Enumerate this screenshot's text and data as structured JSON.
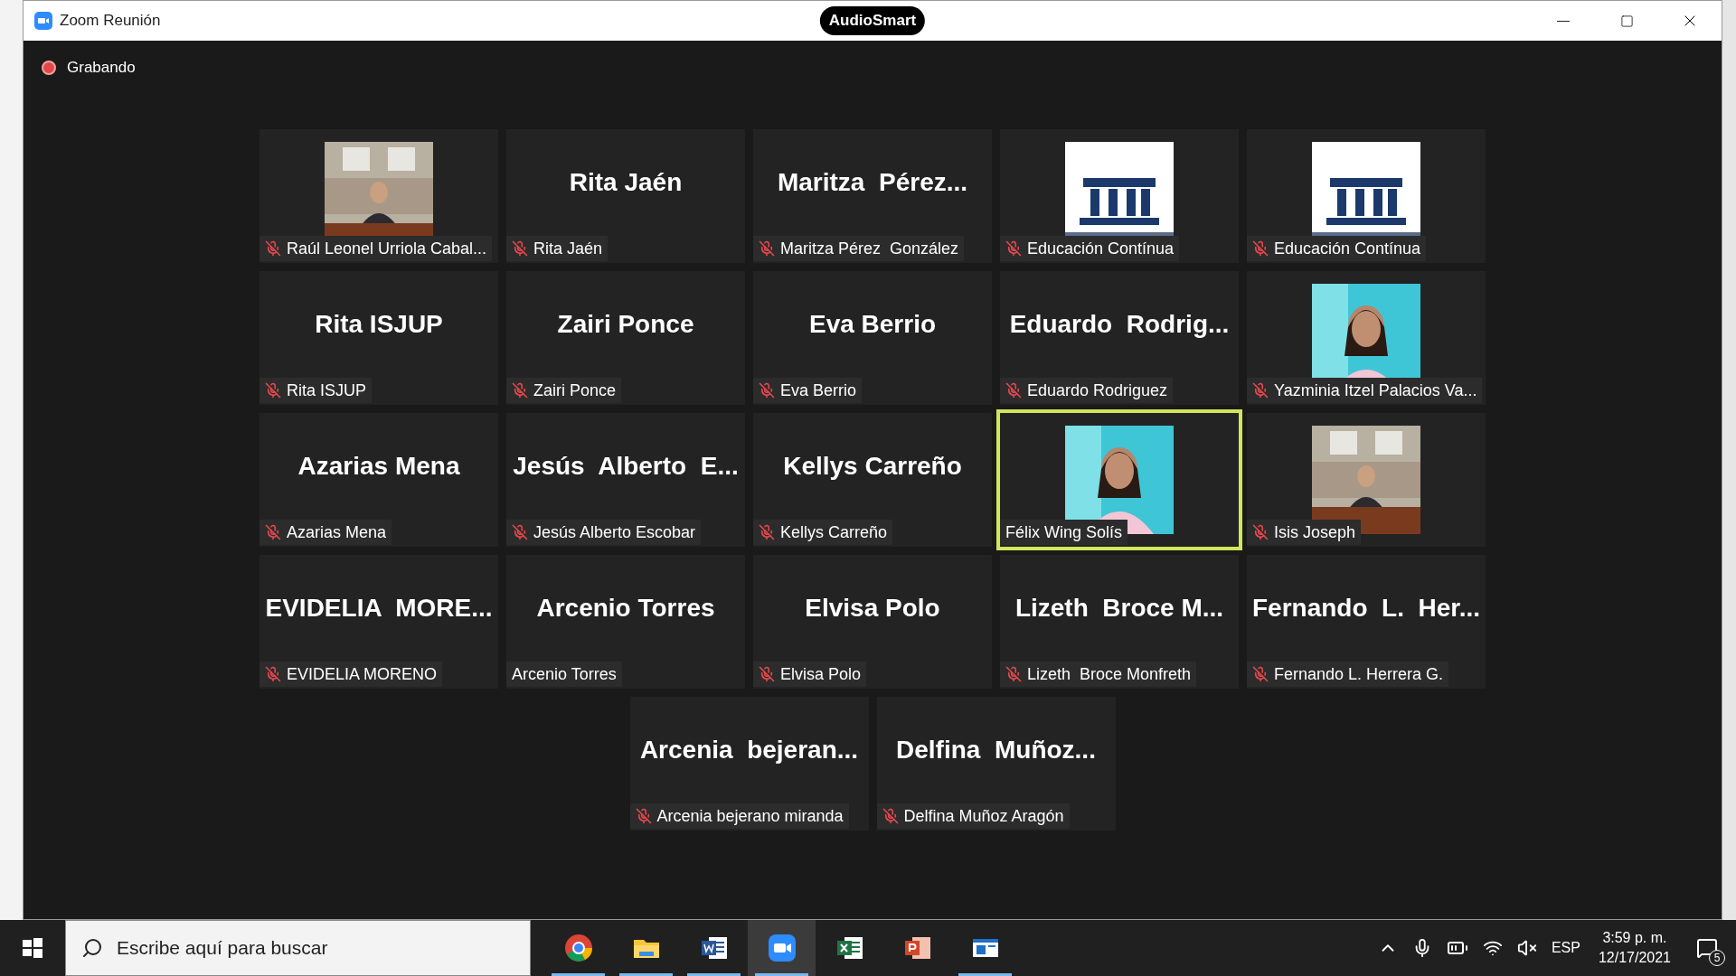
{
  "window": {
    "title": "Zoom Reunión",
    "badge": "AudioSmart"
  },
  "recording": {
    "label": "Grabando",
    "on": true
  },
  "tiles": [
    {
      "kind": "picture",
      "label": "Raúl Leonel Urriola Cabal...",
      "muted": true,
      "selected": false
    },
    {
      "kind": "name",
      "name": "Rita Jaén",
      "label": "Rita Jaén",
      "muted": true,
      "selected": false
    },
    {
      "kind": "name",
      "name": "Maritza  Pérez...",
      "label": "Maritza Pérez  González",
      "muted": true,
      "selected": false
    },
    {
      "kind": "picture",
      "label": "Educación Contínua",
      "muted": true,
      "selected": false
    },
    {
      "kind": "picture",
      "label": "Educación Contínua",
      "muted": true,
      "selected": false
    },
    {
      "kind": "name",
      "name": "Rita ISJUP",
      "label": "Rita ISJUP",
      "muted": true,
      "selected": false
    },
    {
      "kind": "name",
      "name": "Zairi Ponce",
      "label": "Zairi Ponce",
      "muted": true,
      "selected": false
    },
    {
      "kind": "name",
      "name": "Eva Berrio",
      "label": "Eva Berrio",
      "muted": true,
      "selected": false
    },
    {
      "kind": "name",
      "name": "Eduardo  Rodrig...",
      "label": "Eduardo Rodriguez",
      "muted": true,
      "selected": false
    },
    {
      "kind": "picture",
      "label": "Yazminia Itzel Palacios Va...",
      "muted": true,
      "selected": false
    },
    {
      "kind": "name",
      "name": "Azarias Mena",
      "label": "Azarias Mena",
      "muted": true,
      "selected": false
    },
    {
      "kind": "name",
      "name": "Jesús  Alberto  E...",
      "label": "Jesús Alberto Escobar",
      "muted": true,
      "selected": false
    },
    {
      "kind": "name",
      "name": "Kellys Carreño",
      "label": "Kellys Carreño",
      "muted": true,
      "selected": false
    },
    {
      "kind": "picture",
      "label": "Félix Wing Solís",
      "muted": false,
      "selected": true
    },
    {
      "kind": "picture",
      "label": "Isis Joseph",
      "muted": true,
      "selected": false
    },
    {
      "kind": "name",
      "name": "EVIDELIA  MORE...",
      "label": "EVIDELIA MORENO",
      "muted": true,
      "selected": false
    },
    {
      "kind": "name",
      "name": "Arcenio Torres",
      "label": "Arcenio Torres",
      "muted": false,
      "selected": false
    },
    {
      "kind": "name",
      "name": "Elvisa Polo",
      "label": "Elvisa Polo",
      "muted": true,
      "selected": false
    },
    {
      "kind": "name",
      "name": "Lizeth  Broce M...",
      "label": "Lizeth  Broce Monfreth",
      "muted": true,
      "selected": false
    },
    {
      "kind": "name",
      "name": "Fernando  L.  Her...",
      "label": "Fernando L. Herrera G.",
      "muted": true,
      "selected": false
    },
    {
      "kind": "name",
      "name": "Arcenia  bejeran...",
      "label": "Arcenia bejerano miranda",
      "muted": true,
      "selected": false
    },
    {
      "kind": "name",
      "name": "Delfina  Muñoz...",
      "label": "Delfina Muñoz Aragón",
      "muted": true,
      "selected": false
    }
  ],
  "taskbar": {
    "search": {
      "placeholder": "Escribe aquí para buscar"
    },
    "apps": [
      {
        "kind": "chrome",
        "running": true,
        "selected": false
      },
      {
        "kind": "folder",
        "running": true,
        "selected": false
      },
      {
        "kind": "word",
        "running": true,
        "selected": false
      },
      {
        "kind": "zoom",
        "running": true,
        "selected": true
      },
      {
        "kind": "excel",
        "running": false,
        "selected": false
      },
      {
        "kind": "powerpoint",
        "running": false,
        "selected": false
      },
      {
        "kind": "window",
        "running": true,
        "selected": false
      }
    ],
    "language": "ESP",
    "time": "3:59 p. m.",
    "date": "12/17/2021",
    "notifications": "5"
  }
}
